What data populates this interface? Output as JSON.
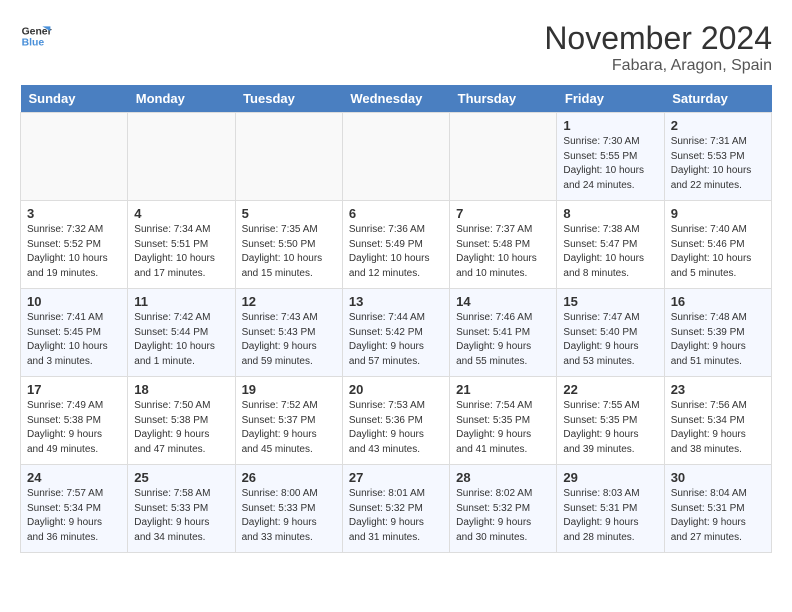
{
  "logo": {
    "line1": "General",
    "line2": "Blue"
  },
  "title": "November 2024",
  "location": "Fabara, Aragon, Spain",
  "days_of_week": [
    "Sunday",
    "Monday",
    "Tuesday",
    "Wednesday",
    "Thursday",
    "Friday",
    "Saturday"
  ],
  "weeks": [
    [
      {
        "day": "",
        "info": ""
      },
      {
        "day": "",
        "info": ""
      },
      {
        "day": "",
        "info": ""
      },
      {
        "day": "",
        "info": ""
      },
      {
        "day": "",
        "info": ""
      },
      {
        "day": "1",
        "info": "Sunrise: 7:30 AM\nSunset: 5:55 PM\nDaylight: 10 hours and 24 minutes."
      },
      {
        "day": "2",
        "info": "Sunrise: 7:31 AM\nSunset: 5:53 PM\nDaylight: 10 hours and 22 minutes."
      }
    ],
    [
      {
        "day": "3",
        "info": "Sunrise: 7:32 AM\nSunset: 5:52 PM\nDaylight: 10 hours and 19 minutes."
      },
      {
        "day": "4",
        "info": "Sunrise: 7:34 AM\nSunset: 5:51 PM\nDaylight: 10 hours and 17 minutes."
      },
      {
        "day": "5",
        "info": "Sunrise: 7:35 AM\nSunset: 5:50 PM\nDaylight: 10 hours and 15 minutes."
      },
      {
        "day": "6",
        "info": "Sunrise: 7:36 AM\nSunset: 5:49 PM\nDaylight: 10 hours and 12 minutes."
      },
      {
        "day": "7",
        "info": "Sunrise: 7:37 AM\nSunset: 5:48 PM\nDaylight: 10 hours and 10 minutes."
      },
      {
        "day": "8",
        "info": "Sunrise: 7:38 AM\nSunset: 5:47 PM\nDaylight: 10 hours and 8 minutes."
      },
      {
        "day": "9",
        "info": "Sunrise: 7:40 AM\nSunset: 5:46 PM\nDaylight: 10 hours and 5 minutes."
      }
    ],
    [
      {
        "day": "10",
        "info": "Sunrise: 7:41 AM\nSunset: 5:45 PM\nDaylight: 10 hours and 3 minutes."
      },
      {
        "day": "11",
        "info": "Sunrise: 7:42 AM\nSunset: 5:44 PM\nDaylight: 10 hours and 1 minute."
      },
      {
        "day": "12",
        "info": "Sunrise: 7:43 AM\nSunset: 5:43 PM\nDaylight: 9 hours and 59 minutes."
      },
      {
        "day": "13",
        "info": "Sunrise: 7:44 AM\nSunset: 5:42 PM\nDaylight: 9 hours and 57 minutes."
      },
      {
        "day": "14",
        "info": "Sunrise: 7:46 AM\nSunset: 5:41 PM\nDaylight: 9 hours and 55 minutes."
      },
      {
        "day": "15",
        "info": "Sunrise: 7:47 AM\nSunset: 5:40 PM\nDaylight: 9 hours and 53 minutes."
      },
      {
        "day": "16",
        "info": "Sunrise: 7:48 AM\nSunset: 5:39 PM\nDaylight: 9 hours and 51 minutes."
      }
    ],
    [
      {
        "day": "17",
        "info": "Sunrise: 7:49 AM\nSunset: 5:38 PM\nDaylight: 9 hours and 49 minutes."
      },
      {
        "day": "18",
        "info": "Sunrise: 7:50 AM\nSunset: 5:38 PM\nDaylight: 9 hours and 47 minutes."
      },
      {
        "day": "19",
        "info": "Sunrise: 7:52 AM\nSunset: 5:37 PM\nDaylight: 9 hours and 45 minutes."
      },
      {
        "day": "20",
        "info": "Sunrise: 7:53 AM\nSunset: 5:36 PM\nDaylight: 9 hours and 43 minutes."
      },
      {
        "day": "21",
        "info": "Sunrise: 7:54 AM\nSunset: 5:35 PM\nDaylight: 9 hours and 41 minutes."
      },
      {
        "day": "22",
        "info": "Sunrise: 7:55 AM\nSunset: 5:35 PM\nDaylight: 9 hours and 39 minutes."
      },
      {
        "day": "23",
        "info": "Sunrise: 7:56 AM\nSunset: 5:34 PM\nDaylight: 9 hours and 38 minutes."
      }
    ],
    [
      {
        "day": "24",
        "info": "Sunrise: 7:57 AM\nSunset: 5:34 PM\nDaylight: 9 hours and 36 minutes."
      },
      {
        "day": "25",
        "info": "Sunrise: 7:58 AM\nSunset: 5:33 PM\nDaylight: 9 hours and 34 minutes."
      },
      {
        "day": "26",
        "info": "Sunrise: 8:00 AM\nSunset: 5:33 PM\nDaylight: 9 hours and 33 minutes."
      },
      {
        "day": "27",
        "info": "Sunrise: 8:01 AM\nSunset: 5:32 PM\nDaylight: 9 hours and 31 minutes."
      },
      {
        "day": "28",
        "info": "Sunrise: 8:02 AM\nSunset: 5:32 PM\nDaylight: 9 hours and 30 minutes."
      },
      {
        "day": "29",
        "info": "Sunrise: 8:03 AM\nSunset: 5:31 PM\nDaylight: 9 hours and 28 minutes."
      },
      {
        "day": "30",
        "info": "Sunrise: 8:04 AM\nSunset: 5:31 PM\nDaylight: 9 hours and 27 minutes."
      }
    ]
  ]
}
